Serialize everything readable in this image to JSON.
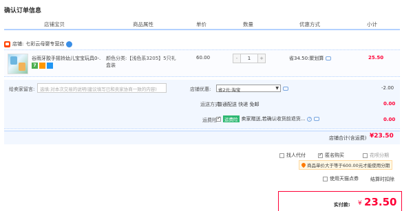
{
  "page_title": "确认订单信息",
  "headers": {
    "shop_item": "店铺宝贝",
    "attr": "商品属性",
    "price": "单价",
    "qty": "数量",
    "promo": "优惠方式",
    "subtotal": "小计"
  },
  "shop": {
    "prefix": "店铺:",
    "name": "七彩云母婴专营店"
  },
  "item": {
    "title": "谷雨牙胶手摇铃幼儿宝宝玩具0-...",
    "badge": "7",
    "props_line1": "颜色分类:【浅色系3205】5只礼",
    "props_line2": "盒装",
    "price": "60.00",
    "qty": "1",
    "qty_minus": "-",
    "qty_plus": "+",
    "promo": "省34.50:聚划算",
    "subtotal": "25.50"
  },
  "message": {
    "label": "给卖家留言:",
    "placeholder": "选填:对本次交易的说明(建议填写已和卖家协商一致的内容)"
  },
  "coupon": {
    "label": "店铺优惠:",
    "selected": "省2元:淘宝",
    "arrow": "▼",
    "amount": "-2.00"
  },
  "shipping": {
    "label": "运送方式:",
    "value": "普通配送 快递 免邮",
    "amount": "0.00"
  },
  "insurance": {
    "label": "运费险:",
    "tag": "运费险",
    "text": "卖家赠送,若确认收货前退货...",
    "amount": "0.00",
    "q": "?"
  },
  "store_total": {
    "label": "店铺合计(含运费)",
    "value": "¥23.50"
  },
  "options": {
    "proxy": "找人代付",
    "anonymous": "匿名购买",
    "installment": "花呗分期"
  },
  "notice": "商品单价大于等于600.00元才能使用分期",
  "points": {
    "label": "使用天猫点券",
    "link": "结算时扣除"
  },
  "pay": {
    "label": "实付款:",
    "symbol": "¥",
    "value": "23.50"
  }
}
